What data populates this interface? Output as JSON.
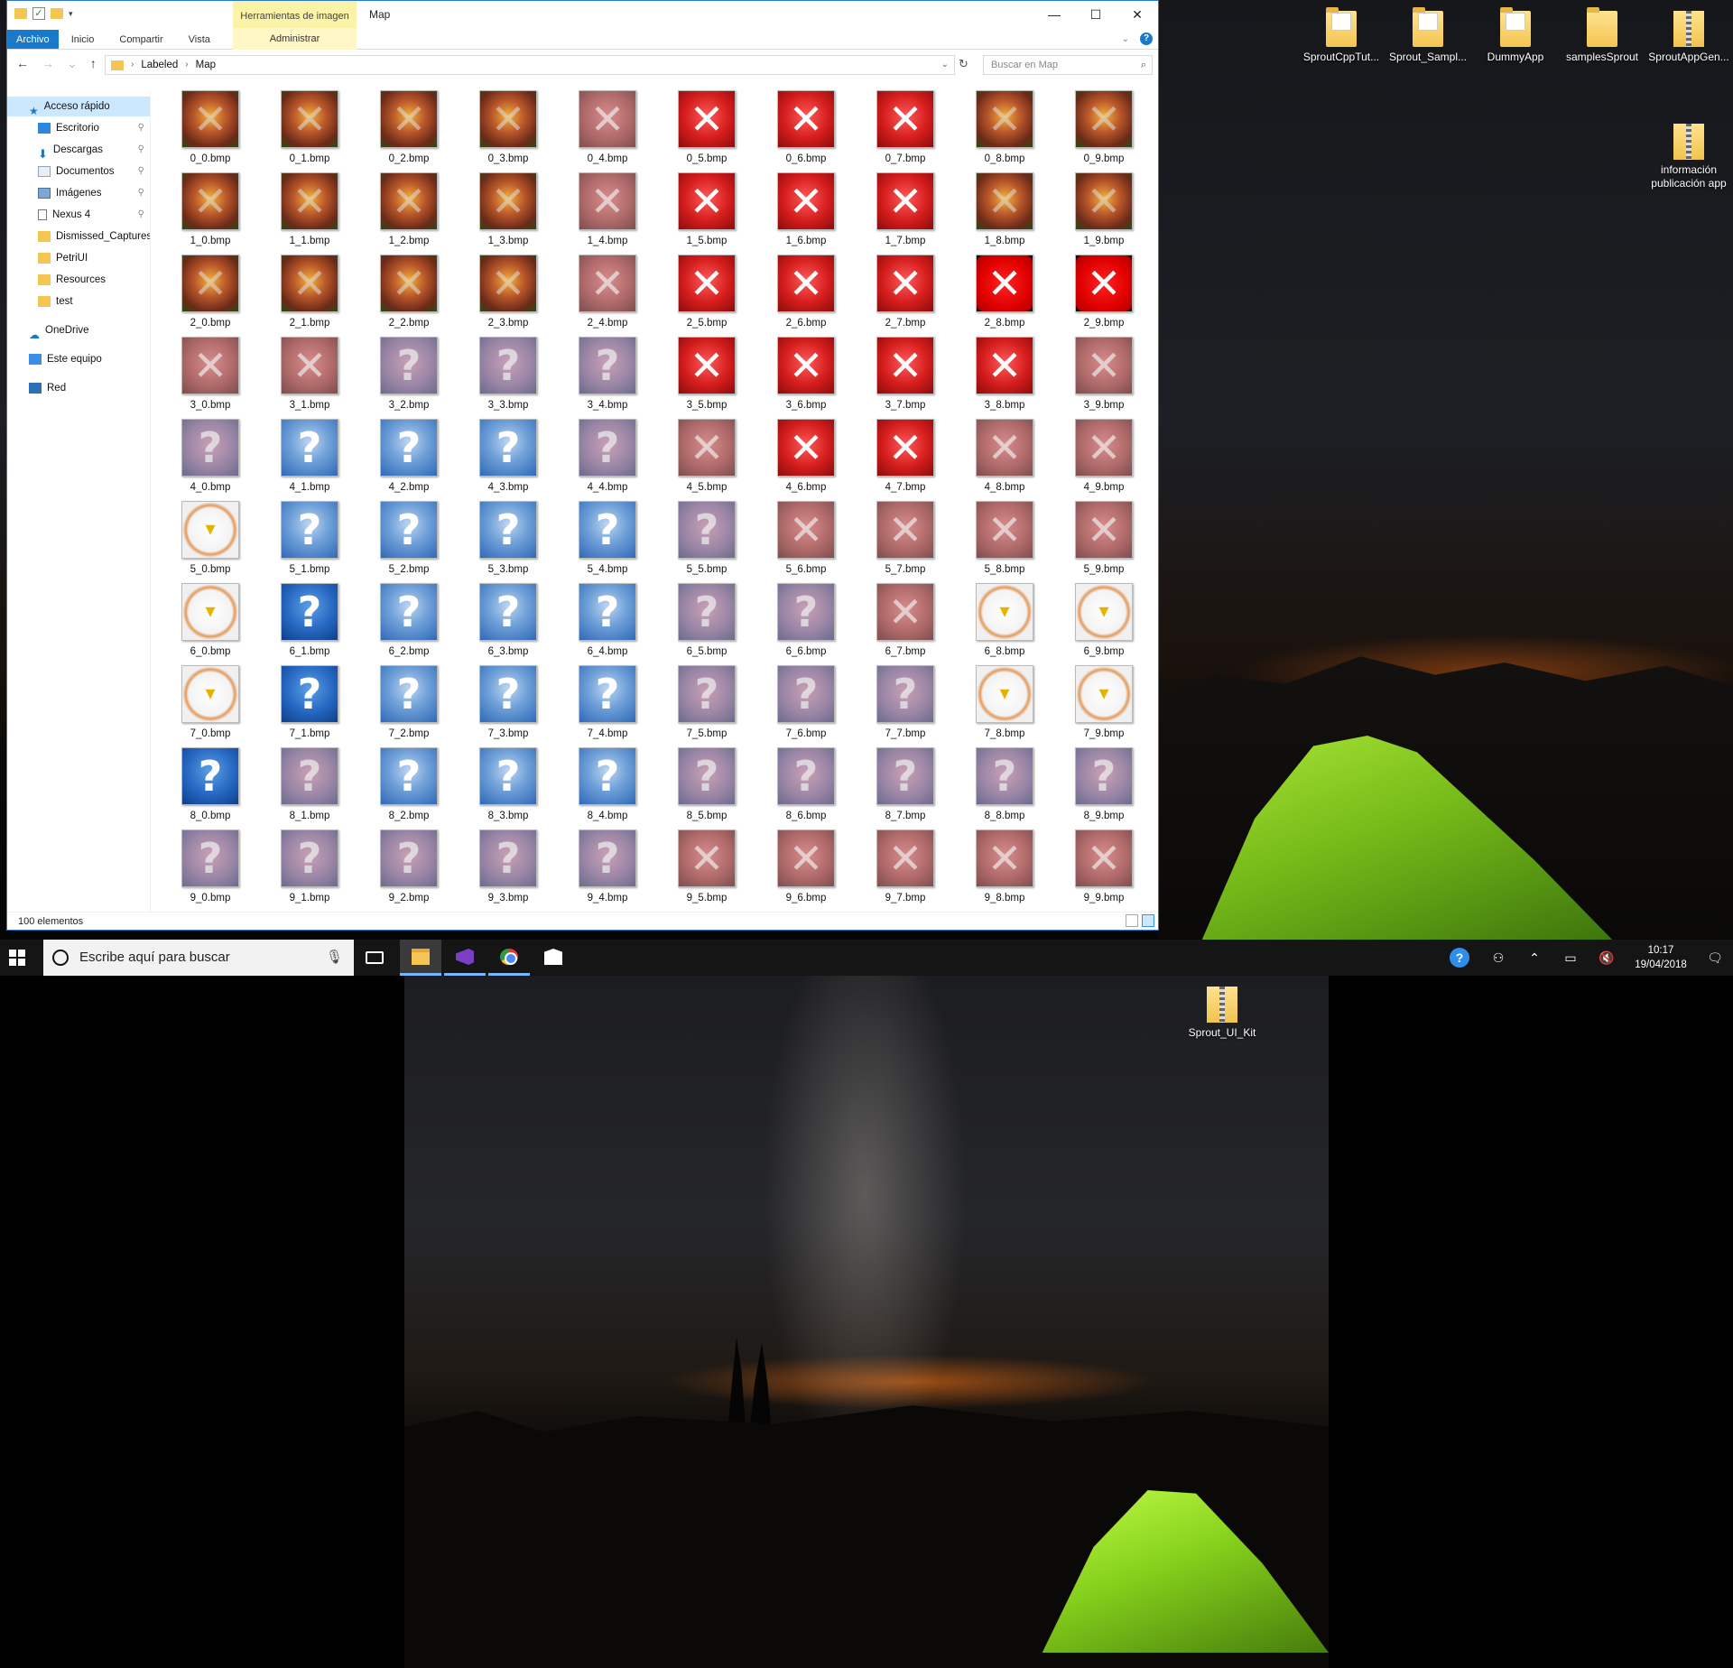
{
  "explorer": {
    "title": "Map",
    "context_tab_group": "Herramientas de imagen",
    "ribbon_tabs": [
      "Archivo",
      "Inicio",
      "Compartir",
      "Vista"
    ],
    "context_tab": "Administrar",
    "address": {
      "crumb1": "Labeled",
      "crumb2": "Map"
    },
    "search_placeholder": "Buscar en Map",
    "nav": {
      "quick_access": "Acceso rápido",
      "items": [
        "Escritorio",
        "Descargas",
        "Documentos",
        "Imágenes",
        "Nexus 4",
        "Dismissed_Captures",
        "PetriUI",
        "Resources",
        "test"
      ],
      "onedrive": "OneDrive",
      "this_pc": "Este equipo",
      "network": "Red"
    },
    "files": [
      [
        "0_0.bmp",
        "0_1.bmp",
        "0_2.bmp",
        "0_3.bmp",
        "0_4.bmp",
        "0_5.bmp",
        "0_6.bmp",
        "0_7.bmp",
        "0_8.bmp",
        "0_9.bmp"
      ],
      [
        "1_0.bmp",
        "1_1.bmp",
        "1_2.bmp",
        "1_3.bmp",
        "1_4.bmp",
        "1_5.bmp",
        "1_6.bmp",
        "1_7.bmp",
        "1_8.bmp",
        "1_9.bmp"
      ],
      [
        "2_0.bmp",
        "2_1.bmp",
        "2_2.bmp",
        "2_3.bmp",
        "2_4.bmp",
        "2_5.bmp",
        "2_6.bmp",
        "2_7.bmp",
        "2_8.bmp",
        "2_9.bmp"
      ],
      [
        "3_0.bmp",
        "3_1.bmp",
        "3_2.bmp",
        "3_3.bmp",
        "3_4.bmp",
        "3_5.bmp",
        "3_6.bmp",
        "3_7.bmp",
        "3_8.bmp",
        "3_9.bmp"
      ],
      [
        "4_0.bmp",
        "4_1.bmp",
        "4_2.bmp",
        "4_3.bmp",
        "4_4.bmp",
        "4_5.bmp",
        "4_6.bmp",
        "4_7.bmp",
        "4_8.bmp",
        "4_9.bmp"
      ],
      [
        "5_0.bmp",
        "5_1.bmp",
        "5_2.bmp",
        "5_3.bmp",
        "5_4.bmp",
        "5_5.bmp",
        "5_6.bmp",
        "5_7.bmp",
        "5_8.bmp",
        "5_9.bmp"
      ],
      [
        "6_0.bmp",
        "6_1.bmp",
        "6_2.bmp",
        "6_3.bmp",
        "6_4.bmp",
        "6_5.bmp",
        "6_6.bmp",
        "6_7.bmp",
        "6_8.bmp",
        "6_9.bmp"
      ],
      [
        "7_0.bmp",
        "7_1.bmp",
        "7_2.bmp",
        "7_3.bmp",
        "7_4.bmp",
        "7_5.bmp",
        "7_6.bmp",
        "7_7.bmp",
        "7_8.bmp",
        "7_9.bmp"
      ],
      [
        "8_0.bmp",
        "8_1.bmp",
        "8_2.bmp",
        "8_3.bmp",
        "8_4.bmp",
        "8_5.bmp",
        "8_6.bmp",
        "8_7.bmp",
        "8_8.bmp",
        "8_9.bmp"
      ],
      [
        "9_0.bmp",
        "9_1.bmp",
        "9_2.bmp",
        "9_3.bmp",
        "9_4.bmp",
        "9_5.bmp",
        "9_6.bmp",
        "9_7.bmp",
        "9_8.bmp",
        "9_9.bmp"
      ]
    ],
    "thumb_styles": [
      [
        "forest",
        "forest",
        "forest",
        "forest",
        "fade",
        "redx",
        "redx",
        "redx",
        "forest",
        "forest"
      ],
      [
        "forest",
        "forest",
        "forest",
        "forest",
        "fade",
        "redx",
        "redx",
        "redx",
        "forest",
        "forest"
      ],
      [
        "forest",
        "forest",
        "forest",
        "forest",
        "fade",
        "redx",
        "redx",
        "redx",
        "dark",
        "dark"
      ],
      [
        "fade",
        "fade",
        "mixed",
        "mixed",
        "mixed",
        "redx",
        "redx",
        "redx",
        "redx",
        "fade"
      ],
      [
        "mixed",
        "blueq",
        "blueq",
        "blueq",
        "mixed",
        "fade",
        "redx",
        "redx",
        "fade",
        "fade"
      ],
      [
        "bulb",
        "blueq",
        "blueq",
        "blueq",
        "blueq",
        "mixed",
        "fade",
        "fade",
        "fade",
        "fade"
      ],
      [
        "bulb",
        "deepq",
        "blueq",
        "blueq",
        "blueq",
        "mixed",
        "mixed",
        "fade",
        "bulb",
        "bulb"
      ],
      [
        "bulb",
        "deepq",
        "blueq",
        "blueq",
        "blueq",
        "mixed",
        "mixed",
        "mixed",
        "bulb",
        "bulb"
      ],
      [
        "deepq",
        "mixed",
        "blueq",
        "blueq",
        "blueq",
        "mixed",
        "mixed",
        "mixed",
        "mixed",
        "mixed"
      ],
      [
        "mixed",
        "mixed",
        "mixed",
        "mixed",
        "mixed",
        "fade",
        "fade",
        "fade",
        "fade",
        "fade"
      ]
    ],
    "status": "100 elementos"
  },
  "desktop_icons": {
    "top_row": [
      "SproutCppTut...",
      "Sprout_Sampl...",
      "DummyApp",
      "samplesSprout",
      "SproutAppGen..."
    ],
    "info_app": "información publicación app",
    "bottom_monitor": "Sprout_UI_Kit"
  },
  "taskbar": {
    "search_placeholder": "Escribe aquí para buscar",
    "time": "10:17",
    "date": "19/04/2018"
  }
}
